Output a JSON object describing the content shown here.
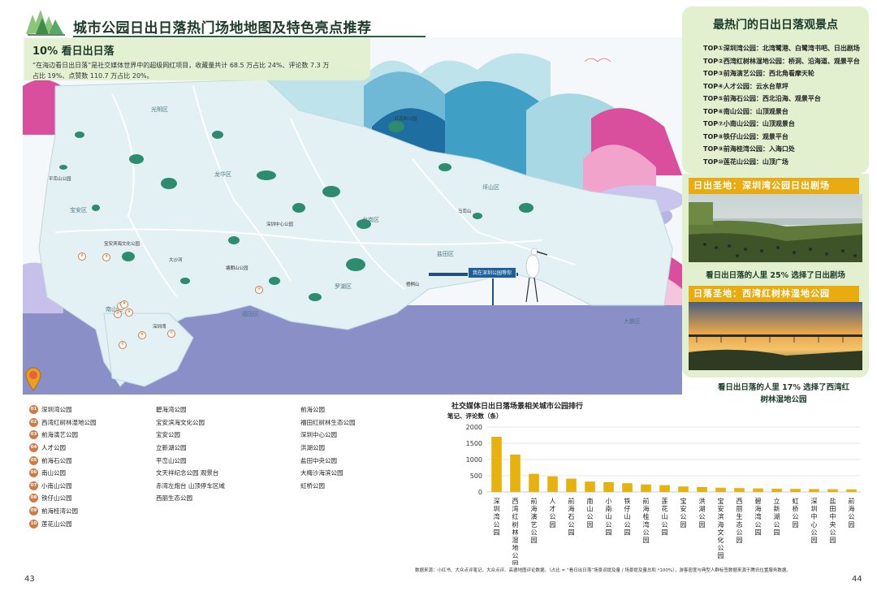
{
  "header": {
    "title": "城市公园日出日落热门场地地图及特色亮点推荐"
  },
  "stat": {
    "title": "10% 看日出日落",
    "text_line1": "“在海边看日出日落”是社交媒体世界中的超级网红项目，收藏量共计 68.5 万占比 24%、评论数 7.3 万",
    "text_line2": "占比 19%、点赞数 110.7 万占比 20%。"
  },
  "map": {
    "districts": [
      "光明区",
      "龙华区",
      "宝安区",
      "坪山区",
      "龙岗区",
      "盐田区",
      "大鹏区",
      "福田区",
      "南山区",
      "罗湖区"
    ],
    "pois": [
      "深圳中心公园",
      "宝安滨海文化公园",
      "红花岭公园",
      "塘朗山公园",
      "平峦山公园",
      "马峦山",
      "梧桐山",
      "大沙河",
      "深圳湾"
    ],
    "sign": "我在深圳公园等你",
    "pin_numbers": [
      "①",
      "②",
      "③",
      "④",
      "⑤",
      "⑥",
      "⑦",
      "⑧",
      "⑨",
      "⑩"
    ]
  },
  "ranking": {
    "title": "最热门的日出日落观景点",
    "items": [
      "TOP①深圳湾公园：北湾鹭港、白鹭湾书吧、日出剧场",
      "TOP②西湾红树林湿地公园：桥洞、沿海道、观景平台",
      "TOP③前海演艺公园：西北角看摩天轮",
      "TOP④人才公园：云水台草坪",
      "TOP⑤前海石公园：西北沿海、观景平台",
      "TOP⑥南山公园：山顶观景台",
      "TOP⑦小南山公园：山顶观景台",
      "TOP⑧铁仔山公园：观景平台",
      "TOP⑨前海桂湾公园：入海口处",
      "TOP⑩莲花山公园：山顶广场"
    ]
  },
  "sunrise": {
    "head": "日出圣地：深圳湾公园日出剧场",
    "caption": "看日出日落的人里 25% 选择了日出剧场"
  },
  "sunset": {
    "head": "日落圣地：西湾红树林湿地公园",
    "caption_line1": "看日出日落的人里 17% 选择了西湾红",
    "caption_line2": "树林湿地公园"
  },
  "legend": {
    "col1": [
      {
        "num": "01",
        "name": "深圳湾公园"
      },
      {
        "num": "02",
        "name": "西湾红树林湿地公园"
      },
      {
        "num": "03",
        "name": "前海演艺公园"
      },
      {
        "num": "04",
        "name": "人才公园"
      },
      {
        "num": "05",
        "name": "前海石公园"
      },
      {
        "num": "06",
        "name": "南山公园"
      },
      {
        "num": "07",
        "name": "小南山公园"
      },
      {
        "num": "08",
        "name": "铁仔山公园"
      },
      {
        "num": "09",
        "name": "前海桂湾公园"
      },
      {
        "num": "10",
        "name": "莲花山公园"
      }
    ],
    "col2": [
      "碧海湾公园",
      "宝安滨海文化公园",
      "宝安公园",
      "立新湖公园",
      "平峦山公园",
      "文天祥纪念公园 观景台",
      "赤湾左炮台 山顶停车区域",
      "西丽生态公园"
    ],
    "col3": [
      "前海公园",
      "福田红树林生态公园",
      "深圳中心公园",
      "洪湖公园",
      "盐田中央公园",
      "大梅沙海滨公园",
      "虹桥公园"
    ]
  },
  "chart_data": {
    "type": "bar",
    "title": "社交媒体日出日落场景相关城市公园排行",
    "ylabel": "笔记、评论数（条）",
    "ylim": [
      0,
      2000
    ],
    "yticks": [
      0,
      500,
      1000,
      1500,
      2000
    ],
    "categories": [
      "深圳湾公园",
      "西湾红树林湿地公园",
      "前海演艺公园",
      "人才公园",
      "前海石公园",
      "南山公园",
      "小南山公园",
      "铁仔山公园",
      "前海桂湾公园",
      "莲花山公园",
      "宝安公园",
      "洪湖公园",
      "宝安滨海文化公园",
      "西丽生态公园",
      "碧海湾公园",
      "立新湖公园",
      "虹桥公园",
      "深圳中心公园",
      "盐田中央公园",
      "前海公园"
    ],
    "values": [
      1700,
      1150,
      560,
      480,
      410,
      320,
      300,
      270,
      230,
      210,
      170,
      150,
      130,
      120,
      110,
      100,
      95,
      90,
      85,
      80
    ],
    "bar_color": "#e8b20e"
  },
  "footer": {
    "source": "数据来源：小红书、大众点评笔记，大众点评、高德地图评论数据。（占比 = “看日出日落”场景词提及量 / 场景提及量总和 *100%），游客密度与典型人群标签数据来源于腾讯位置服务数据。",
    "page_left": "43",
    "page_right": "44"
  },
  "colors": {
    "panel_bg": "#e2f0d0",
    "accent": "#e8ab10",
    "map_land": "#e3f0f4",
    "map_sea": "#8a8fc8",
    "park": "#2e8c6e",
    "pin": "#d07a45"
  }
}
